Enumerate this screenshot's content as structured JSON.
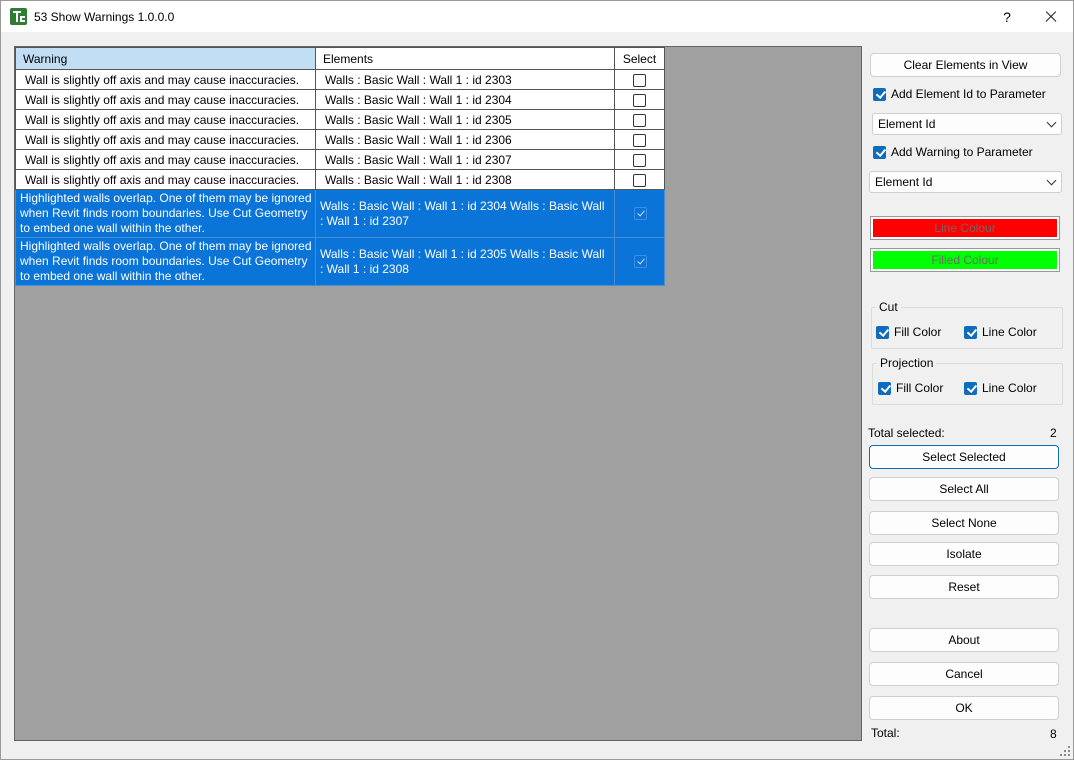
{
  "window": {
    "title": "53 Show Warnings 1.0.0.0",
    "help": "?"
  },
  "grid": {
    "headers": {
      "warning": "Warning",
      "elements": "Elements",
      "select": "Select"
    },
    "rows": [
      {
        "warning": "Wall is slightly off axis and may cause inaccuracies.",
        "elements": " Walls : Basic Wall : Wall 1 : id 2303",
        "checked": false,
        "highlighted": false
      },
      {
        "warning": "Wall is slightly off axis and may cause inaccuracies.",
        "elements": " Walls : Basic Wall : Wall 1 : id 2304",
        "checked": false,
        "highlighted": false
      },
      {
        "warning": "Wall is slightly off axis and may cause inaccuracies.",
        "elements": " Walls : Basic Wall : Wall 1 : id 2305",
        "checked": false,
        "highlighted": false
      },
      {
        "warning": "Wall is slightly off axis and may cause inaccuracies.",
        "elements": " Walls : Basic Wall : Wall 1 : id 2306",
        "checked": false,
        "highlighted": false
      },
      {
        "warning": "Wall is slightly off axis and may cause inaccuracies.",
        "elements": " Walls : Basic Wall : Wall 1 : id 2307",
        "checked": false,
        "highlighted": false
      },
      {
        "warning": "Wall is slightly off axis and may cause inaccuracies.",
        "elements": " Walls : Basic Wall : Wall 1 : id 2308",
        "checked": false,
        "highlighted": false
      },
      {
        "warning": " Highlighted walls overlap. One of them may be ignored when Revit finds room boundaries. Use Cut Geometry to embed one wall within the other.",
        "elements": " Walls : Basic Wall : Wall 1 : id 2304    Walls : Basic Wall : Wall 1 : id 2307",
        "checked": true,
        "highlighted": true
      },
      {
        "warning": " Highlighted walls overlap. One of them may be ignored when Revit finds room boundaries. Use Cut Geometry to embed one wall within the other.",
        "elements": " Walls : Basic Wall : Wall 1 : id 2305    Walls : Basic Wall : Wall 1 : id 2308",
        "checked": true,
        "highlighted": true
      }
    ]
  },
  "panel": {
    "clear_elements": "Clear Elements in View",
    "add_element_id": {
      "label": "Add Element Id to Parameter",
      "checked": true
    },
    "element_param_combo": "Element Id",
    "add_warning": {
      "label": "Add Warning to Parameter",
      "checked": true
    },
    "warning_param_combo": "Element Id",
    "line_colour": {
      "label": "Line Colour",
      "color": "#ff0000"
    },
    "filled_colour": {
      "label": "Filled Colour",
      "color": "#00ff00"
    },
    "cut": {
      "title": "Cut",
      "fill": "Fill Color",
      "line": "Line Color"
    },
    "projection": {
      "title": "Projection",
      "fill": "Fill Color",
      "line": "Line Color"
    },
    "total_selected_label": "Total selected:",
    "total_selected_value": "2",
    "select_selected": "Select Selected",
    "select_all": "Select All",
    "select_none": "Select None",
    "isolate": "Isolate",
    "reset": "Reset",
    "about": "About",
    "cancel": "Cancel",
    "ok": "OK",
    "total_label": "Total:",
    "total_value": "8"
  },
  "colors": {
    "selection": "#0a74d8",
    "header_active": "#c2def4",
    "grid_bg": "#a0a0a0"
  }
}
